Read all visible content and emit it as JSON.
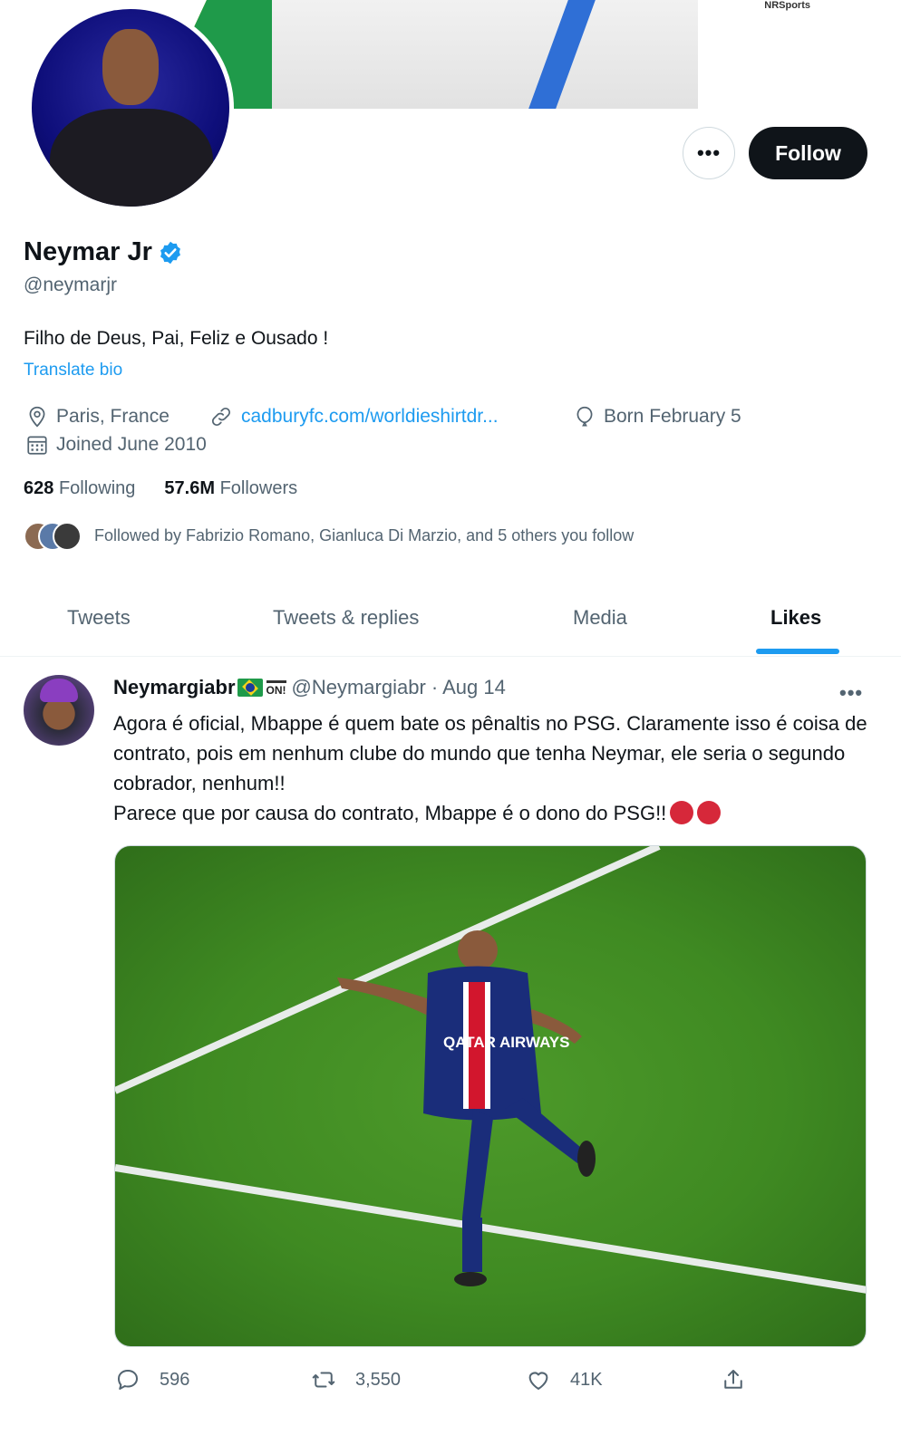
{
  "banner": {
    "brand": "NRSports"
  },
  "profile": {
    "name": "Neymar Jr",
    "handle": "@neymarjr",
    "bio": "Filho de Deus, Pai, Feliz e Ousado !",
    "translate_label": "Translate bio",
    "location": "Paris, France",
    "website": "cadburyfc.com/worldieshirtdr...",
    "birthday": "Born February 5",
    "joined": "Joined June 2010",
    "following_count": "628",
    "following_label": "Following",
    "followers_count": "57.6M",
    "followers_label": "Followers",
    "followed_by": "Followed by Fabrizio Romano, Gianluca Di Marzio, and 5 others you follow"
  },
  "buttons": {
    "more": "•••",
    "follow": "Follow"
  },
  "tabs": [
    {
      "label": "Tweets"
    },
    {
      "label": "Tweets & replies"
    },
    {
      "label": "Media"
    },
    {
      "label": "Likes",
      "active": true
    }
  ],
  "tweet": {
    "author_name": "Neymargiabr",
    "badge": "ON!",
    "handle_date": "@Neymargiabr · Aug 14",
    "more": "•••",
    "text_lines": [
      "Agora é oficial, Mbappe é quem bate os pênaltis no PSG. Claramente isso é coisa de contrato, pois em nenhum clube do mundo que tenha Neymar, ele seria o segundo cobrador, nenhum!!",
      "Parece que por causa do contrato, Mbappe é o dono do PSG!!"
    ],
    "media_jersey_text": "QATAR AIRWAYS",
    "replies": "596",
    "retweets": "3,550",
    "likes": "41K"
  },
  "colors": {
    "accent": "#1d9bf0",
    "text": "#0f1419",
    "muted": "#536471"
  }
}
